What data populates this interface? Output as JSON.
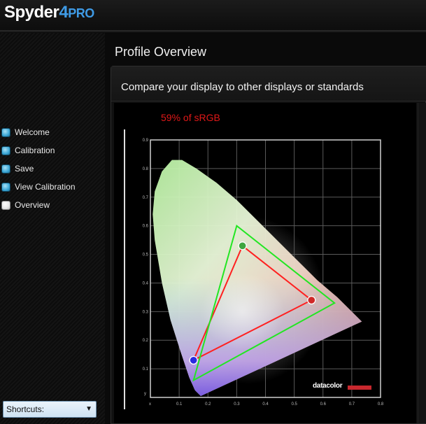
{
  "app": {
    "logo_word": "Spyder",
    "logo_num": "4",
    "logo_suffix": "PRO"
  },
  "sidebar": {
    "items": [
      {
        "label": "Welcome",
        "active": false
      },
      {
        "label": "Calibration",
        "active": false
      },
      {
        "label": "Save",
        "active": false
      },
      {
        "label": "View Calibration",
        "active": false
      },
      {
        "label": "Overview",
        "active": true
      }
    ],
    "shortcuts_label": "Shortcuts:"
  },
  "main": {
    "title": "Profile Overview",
    "panel_heading": "Compare your display to other displays or standards",
    "gamut_label": "59% of sRGB",
    "brand": "datacolor"
  },
  "colors": {
    "display_gamut": "#ff2020",
    "srgb_gamut": "#22e622",
    "label_red": "#e01818"
  },
  "chart_data": {
    "type": "scatter",
    "title": "",
    "xlabel": "x",
    "ylabel": "y",
    "xlim": [
      0,
      0.8
    ],
    "ylim": [
      0,
      0.9
    ],
    "xticks": [
      "0.1",
      "0.2",
      "0.3",
      "0.4",
      "0.5",
      "0.6",
      "0.7",
      "0.8"
    ],
    "yticks": [
      "0.1",
      "0.2",
      "0.3",
      "0.4",
      "0.5",
      "0.6",
      "0.7",
      "0.8",
      "0.9"
    ],
    "grid": true,
    "series": [
      {
        "points": [
          [
            0.15,
            0.13
          ],
          [
            0.32,
            0.53
          ],
          [
            0.56,
            0.34
          ]
        ],
        "color": "#ff2020"
      },
      {
        "points": [
          [
            0.15,
            0.06
          ],
          [
            0.3,
            0.6
          ],
          [
            0.64,
            0.33
          ]
        ],
        "color": "#22e622"
      }
    ]
  }
}
